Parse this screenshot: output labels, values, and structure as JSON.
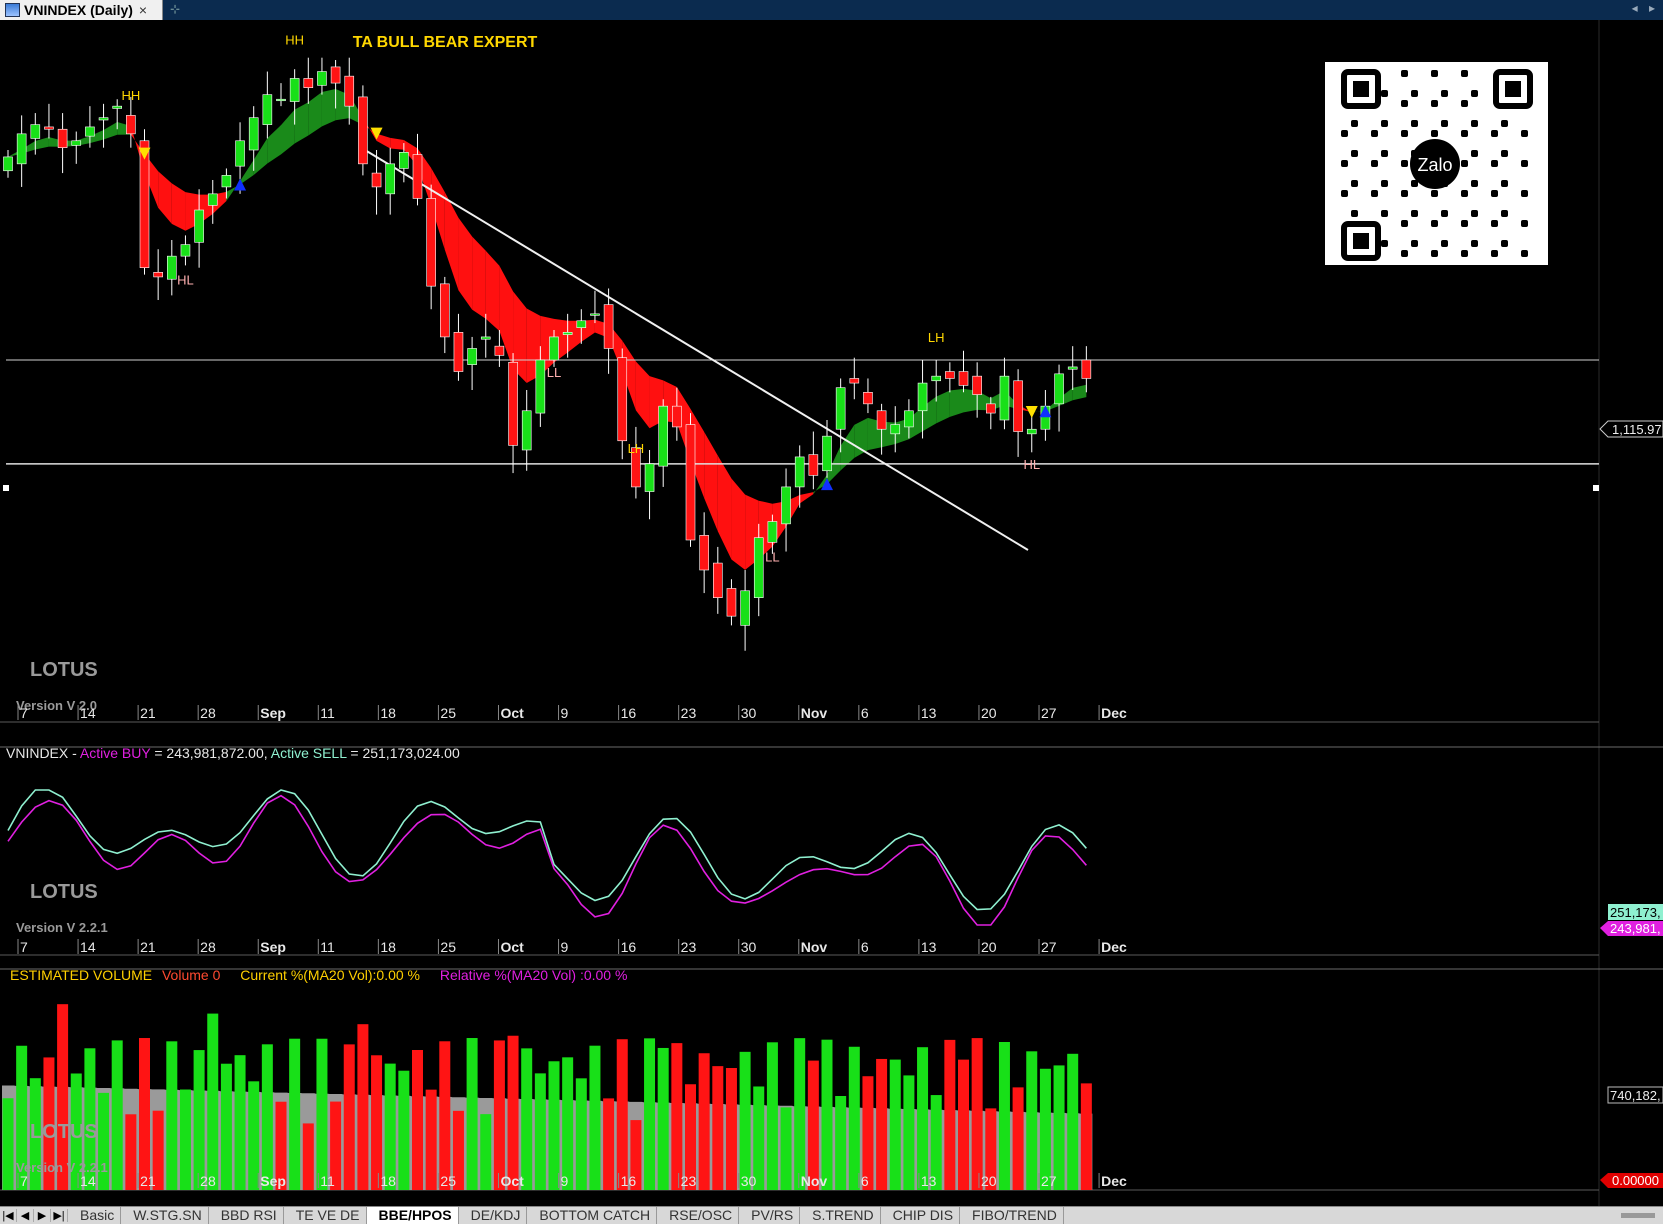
{
  "window": {
    "tab_title": "VNINDEX (Daily)",
    "close_label": "×",
    "pin_label": "⊹",
    "nav_label": "◂ ▸"
  },
  "main_panel": {
    "title": "TA BULL BEAR EXPERT",
    "brand": "LOTUS",
    "version": "Version V 2.0",
    "price_label": "1,115.97",
    "pattern_labels": [
      "HH",
      "HH",
      "HL",
      "LH",
      "LL",
      "LL",
      "LH",
      "HL"
    ],
    "qr_text": "Zalo"
  },
  "x_axis_ticks": [
    "7",
    "14",
    "21",
    "28",
    "Sep",
    "11",
    "18",
    "25",
    "Oct",
    "9",
    "16",
    "23",
    "30",
    "Nov",
    "6",
    "13",
    "20",
    "27",
    "Dec"
  ],
  "flow_panel": {
    "symbol": "VNINDEX",
    "separator": " - ",
    "buy_label": "Active BUY",
    "buy_value": " = 243,981,872.00,",
    "sell_label": " Active SELL",
    "sell_value": " = 251,173,024.00",
    "brand": "LOTUS",
    "version": "Version V 2.2.1",
    "sell_axis_label": "251,173,",
    "buy_axis_label": "243,981,"
  },
  "volume_panel": {
    "title": "ESTIMATED VOLUME",
    "volume_text": "Volume 0",
    "current_text": "Current %(MA20 Vol):0.00 %",
    "relative_text": "Relative %(MA20 Vol) :0.00 %",
    "brand": "LOTUS",
    "version": "Version V 2.2.1",
    "axis_label": "740,182,",
    "zero_label": "0.00000"
  },
  "bottom_tabs": [
    "Basic",
    "W.STG.SN",
    "BBD RSI",
    "TE VE DE",
    "BBE/HPOS",
    "DE/KDJ",
    "BOTTOM CATCH",
    "RSE/OSC",
    "PV/RS",
    "S.TREND",
    "CHIP DIS",
    "FIBO/TREND"
  ],
  "active_tab": "BBE/HPOS",
  "nav_buttons": [
    "|◀",
    "◀",
    "▶",
    "▶|"
  ],
  "colors": {
    "up": "#18e018",
    "down": "#ff1414",
    "ribbon_up": "#1a8a1a",
    "ribbon_down": "#ff1010",
    "buy": "#e020e0",
    "sell": "#8ff0d0",
    "title": "#ffd700",
    "vol_ma": "#9a9a9a"
  },
  "chart_data": [
    {
      "type": "candlestick",
      "title": "TA BULL BEAR EXPERT",
      "symbol": "VNINDEX (Daily)",
      "x_ticks": [
        "7",
        "14",
        "21",
        "28",
        "Sep",
        "11",
        "18",
        "25",
        "Oct",
        "9",
        "16",
        "23",
        "30",
        "Nov",
        "6",
        "13",
        "20",
        "27",
        "Dec"
      ],
      "y_range_approx": [
        1010,
        1270
      ],
      "horizontal_lines": [
        1140,
        1095
      ],
      "last_price": 1115.97,
      "closes": [
        1228,
        1238,
        1242,
        1240,
        1232,
        1235,
        1241,
        1245,
        1250,
        1238,
        1180,
        1176,
        1185,
        1190,
        1205,
        1212,
        1220,
        1235,
        1245,
        1255,
        1253,
        1262,
        1258,
        1265,
        1260,
        1250,
        1225,
        1215,
        1225,
        1230,
        1210,
        1172,
        1150,
        1135,
        1145,
        1150,
        1142,
        1103,
        1118,
        1140,
        1150,
        1152,
        1157,
        1160,
        1145,
        1105,
        1085,
        1095,
        1120,
        1111,
        1062,
        1049,
        1037,
        1029,
        1040,
        1063,
        1070,
        1085,
        1098,
        1090,
        1107,
        1128,
        1130,
        1121,
        1110,
        1112,
        1118,
        1130,
        1133,
        1132,
        1129,
        1125,
        1117,
        1133,
        1109,
        1110,
        1120,
        1134,
        1137,
        1132
      ],
      "ribbon": "EMA band, green when bullish, red when bearish"
    },
    {
      "type": "line",
      "series": [
        {
          "name": "Active BUY",
          "last": 243981872
        },
        {
          "name": "Active SELL",
          "last": 251173024
        }
      ]
    },
    {
      "type": "bar",
      "title": "ESTIMATED VOLUME",
      "series": [
        {
          "name": "Volume"
        }
      ],
      "ma_band": "MA20 Vol"
    }
  ]
}
